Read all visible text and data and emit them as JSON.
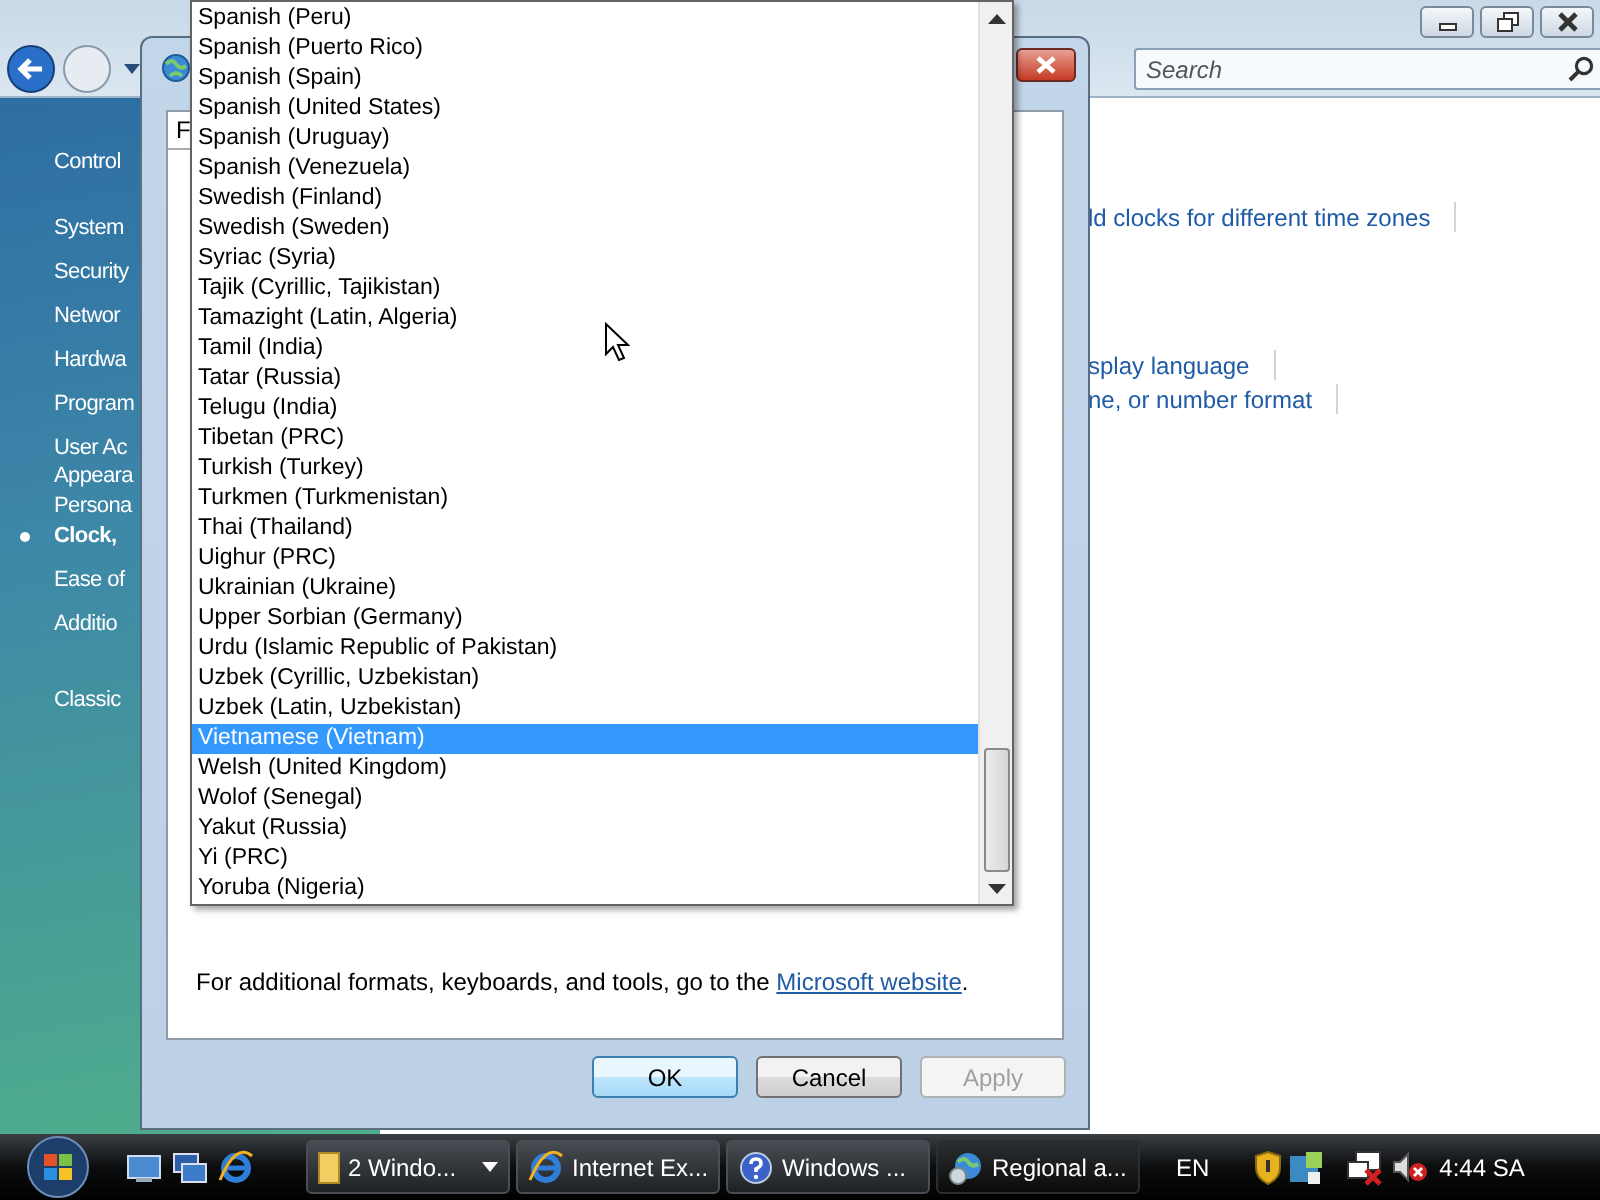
{
  "control_panel": {
    "search": {
      "placeholder": "Search"
    },
    "sidebar": {
      "items": [
        {
          "label": "Control",
          "kind": "home",
          "selected": false
        },
        {
          "label": "System",
          "kind": "category",
          "selected": false
        },
        {
          "label": "Security",
          "kind": "category",
          "selected": false
        },
        {
          "label": "Networ",
          "kind": "category",
          "selected": false
        },
        {
          "label": "Hardwa",
          "kind": "category",
          "selected": false
        },
        {
          "label": "Program",
          "kind": "category",
          "selected": false
        },
        {
          "label": "User Ac",
          "kind": "category",
          "selected": false
        },
        {
          "label": "Appeara\nPersona",
          "kind": "category",
          "selected": false
        },
        {
          "label": "Clock,",
          "kind": "category",
          "selected": true
        },
        {
          "label": "Ease of",
          "kind": "category",
          "selected": false
        },
        {
          "label": "Additio",
          "kind": "category",
          "selected": false
        },
        {
          "label": "Classic",
          "kind": "view",
          "selected": false
        }
      ]
    },
    "links": [
      {
        "label": "ld clocks for different time zones",
        "kind": "first"
      },
      {
        "label": "splay language",
        "kind": "group"
      },
      {
        "label": "ne, or number format",
        "kind": "next"
      }
    ]
  },
  "dialog": {
    "tab": "F",
    "list": {
      "items": [
        {
          "label": "Spanish (Peru)",
          "selected": false
        },
        {
          "label": "Spanish (Puerto Rico)",
          "selected": false
        },
        {
          "label": "Spanish (Spain)",
          "selected": false
        },
        {
          "label": "Spanish (United States)",
          "selected": false
        },
        {
          "label": "Spanish (Uruguay)",
          "selected": false
        },
        {
          "label": "Spanish (Venezuela)",
          "selected": false
        },
        {
          "label": "Swedish (Finland)",
          "selected": false
        },
        {
          "label": "Swedish (Sweden)",
          "selected": false
        },
        {
          "label": "Syriac (Syria)",
          "selected": false
        },
        {
          "label": "Tajik (Cyrillic, Tajikistan)",
          "selected": false
        },
        {
          "label": "Tamazight (Latin, Algeria)",
          "selected": false
        },
        {
          "label": "Tamil (India)",
          "selected": false
        },
        {
          "label": "Tatar (Russia)",
          "selected": false
        },
        {
          "label": "Telugu (India)",
          "selected": false
        },
        {
          "label": "Tibetan (PRC)",
          "selected": false
        },
        {
          "label": "Turkish (Turkey)",
          "selected": false
        },
        {
          "label": "Turkmen (Turkmenistan)",
          "selected": false
        },
        {
          "label": "Thai (Thailand)",
          "selected": false
        },
        {
          "label": "Uighur (PRC)",
          "selected": false
        },
        {
          "label": "Ukrainian (Ukraine)",
          "selected": false
        },
        {
          "label": "Upper Sorbian (Germany)",
          "selected": false
        },
        {
          "label": "Urdu (Islamic Republic of Pakistan)",
          "selected": false
        },
        {
          "label": "Uzbek (Cyrillic, Uzbekistan)",
          "selected": false
        },
        {
          "label": "Uzbek (Latin, Uzbekistan)",
          "selected": false
        },
        {
          "label": "Vietnamese (Vietnam)",
          "selected": true
        },
        {
          "label": "Welsh (United Kingdom)",
          "selected": false
        },
        {
          "label": "Wolof (Senegal)",
          "selected": false
        },
        {
          "label": "Yakut (Russia)",
          "selected": false
        },
        {
          "label": "Yi (PRC)",
          "selected": false
        },
        {
          "label": "Yoruba (Nigeria)",
          "selected": false
        }
      ]
    },
    "footer": {
      "text": "For additional formats, keyboards, and tools, go to the ",
      "link": "Microsoft website",
      "end": "."
    },
    "buttons": [
      {
        "label": "OK",
        "kind": "default",
        "disabled": false
      },
      {
        "label": "Cancel",
        "kind": "normal",
        "disabled": false
      },
      {
        "label": "Apply",
        "kind": "normal",
        "disabled": true
      }
    ]
  },
  "taskbar": {
    "tasks": [
      {
        "label": "2 Windo...",
        "kind": "folder",
        "active": false
      },
      {
        "label": "Internet Ex...",
        "kind": "browser",
        "active": false
      },
      {
        "label": "Windows ...",
        "kind": "help",
        "active": false
      },
      {
        "label": "Regional a...",
        "kind": "globe",
        "active": true
      }
    ],
    "language": "EN",
    "clock": "4:44 SA"
  }
}
